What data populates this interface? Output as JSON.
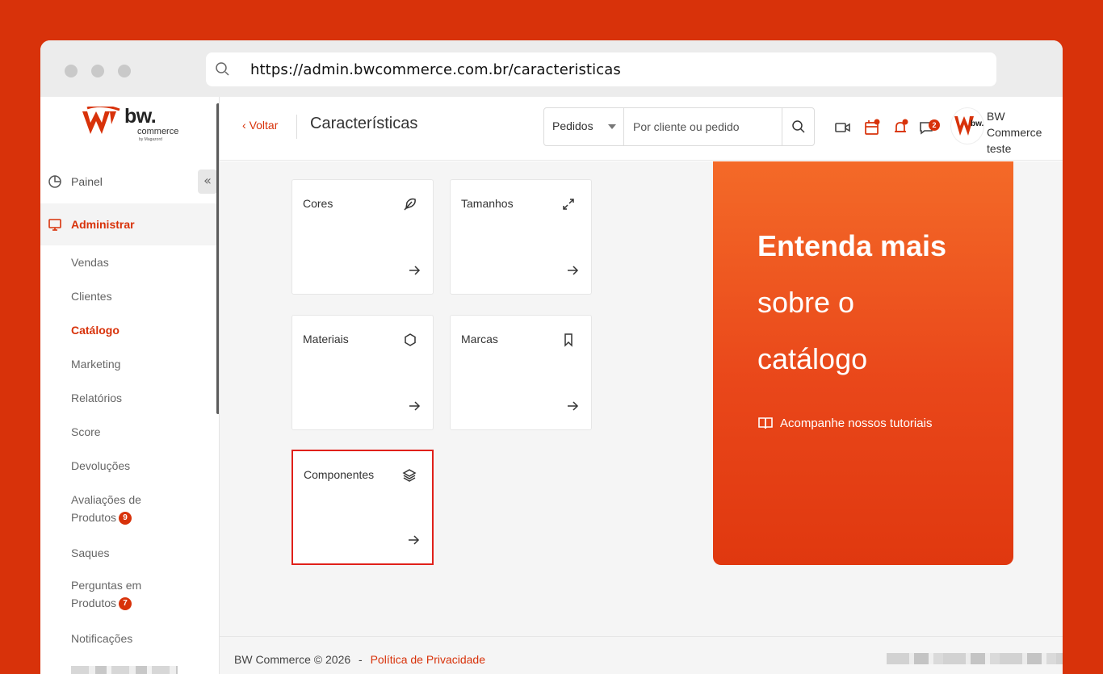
{
  "browser": {
    "url": "https://admin.bwcommerce.com.br/caracteristicas"
  },
  "logo": {
    "brand": "bw.",
    "sub": "commerce",
    "by": "by Magazord"
  },
  "sidebar": {
    "collapse_label": "«",
    "sections": [
      {
        "label": "Painel"
      },
      {
        "label": "Administrar"
      }
    ],
    "items": [
      {
        "label": "Vendas"
      },
      {
        "label": "Clientes"
      },
      {
        "label": "Catálogo"
      },
      {
        "label": "Marketing"
      },
      {
        "label": "Relatórios"
      },
      {
        "label": "Score"
      },
      {
        "label": "Devoluções"
      },
      {
        "label": "Avaliações de",
        "label2": "Produtos",
        "badge": "9"
      },
      {
        "label": "Saques"
      },
      {
        "label": "Perguntas em",
        "label2": "Produtos",
        "badge": "7"
      },
      {
        "label": "Notificações"
      }
    ]
  },
  "header": {
    "back_label": "Voltar",
    "title": "Características",
    "search_select": "Pedidos",
    "search_placeholder": "Por cliente ou pedido",
    "chat_badge": "2",
    "user_name": "BW Commerce",
    "user_sub": "teste"
  },
  "cards": [
    {
      "label": "Cores",
      "icon": "feather-icon"
    },
    {
      "label": "Tamanhos",
      "icon": "expand-icon"
    },
    {
      "label": "Materiais",
      "icon": "hexagon-icon"
    },
    {
      "label": "Marcas",
      "icon": "bookmark-icon"
    },
    {
      "label": "Componentes",
      "icon": "layers-icon"
    }
  ],
  "promo": {
    "line1": "Entenda mais",
    "line2": "sobre o",
    "line3": "catálogo",
    "link": "Acompanhe nossos tutoriais"
  },
  "footer": {
    "copyright": "BW Commerce © 2026",
    "separator": "-",
    "privacy": "Política de Privacidade"
  },
  "colors": {
    "background": "#d8320a",
    "accent": "#d8320a",
    "selected_border": "#e0201a"
  }
}
